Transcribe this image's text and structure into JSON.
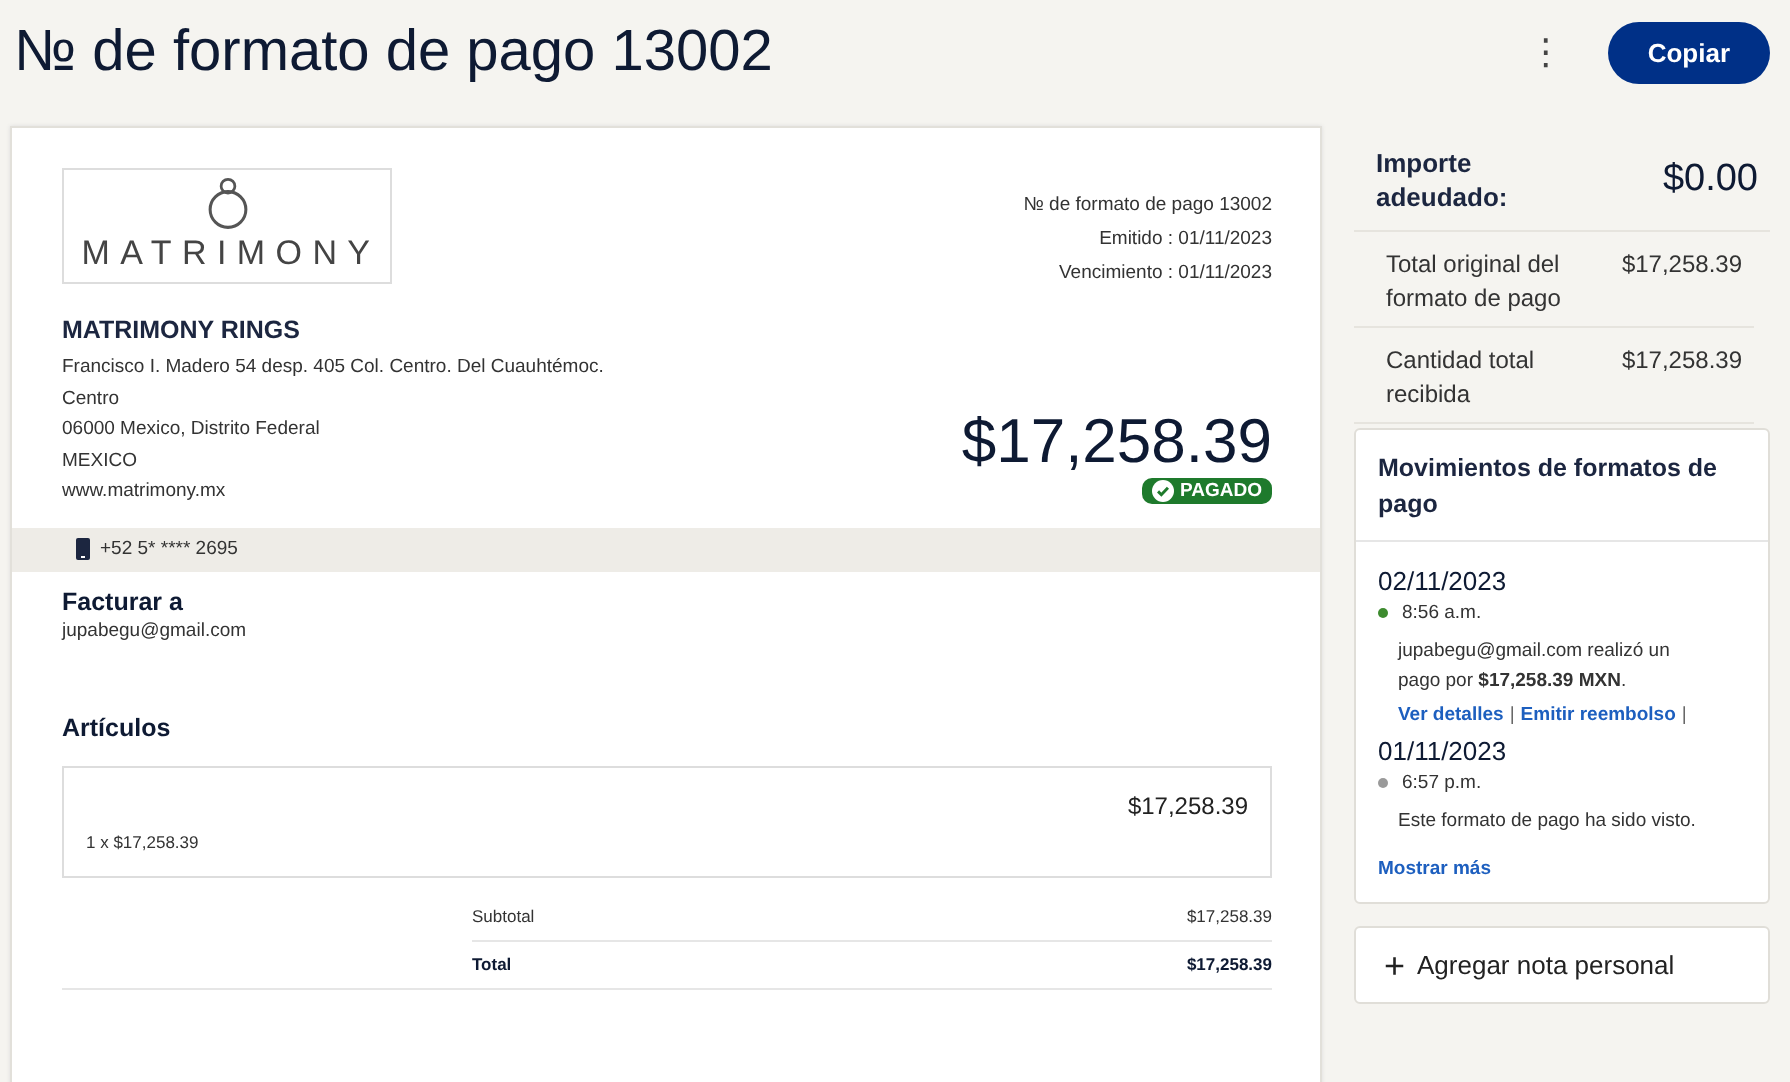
{
  "header": {
    "title": "№ de formato de pago 13002",
    "more_menu": "⋮",
    "copy_button": "Copiar"
  },
  "invoice": {
    "logo_text": "MATRIMONY",
    "meta": [
      "№ de formato de pago 13002",
      "Emitido : 01/11/2023",
      "Vencimiento : 01/11/2023"
    ],
    "merchant": {
      "name": "MATRIMONY RINGS",
      "address_lines": [
        "Francisco I. Madero 54 desp. 405 Col. Centro. Del Cuauhtémoc.",
        "Centro",
        "06000 Mexico, Distrito Federal",
        "MEXICO"
      ],
      "website": "www.matrimony.mx"
    },
    "amount": "$17,258.39",
    "status": {
      "label": "PAGADO",
      "kind": "paid"
    },
    "phone": "+52 5* **** 2695",
    "bill_to": {
      "heading": "Facturar a",
      "email": "jupabegu@gmail.com"
    },
    "items_heading": "Artículos",
    "items": [
      {
        "amount": "$17,258.39",
        "detail": "1 x $17,258.39"
      }
    ],
    "totals": [
      {
        "label": "Subtotal",
        "value": "$17,258.39",
        "bold": false
      },
      {
        "label": "Total",
        "value": "$17,258.39",
        "bold": true
      }
    ]
  },
  "summary": {
    "due_label": "Importe adeudado:",
    "due_value": "$0.00",
    "rows": [
      {
        "label": "Total original del formato de pago",
        "value": "$17,258.39"
      },
      {
        "label": "Cantidad total recibida",
        "value": "$17,258.39"
      }
    ]
  },
  "activity": {
    "title": "Movimientos de formatos de pago",
    "events": [
      {
        "date": "02/11/2023",
        "time": "8:56 a.m.",
        "color": "#3d8b2f",
        "message": "jupabegu@gmail.com realizó un pago por **$17,258.39 MXN**.",
        "links": [
          {
            "label": "Ver detalles"
          },
          {
            "label": "Emitir reembolso"
          }
        ],
        "separator": "|"
      },
      {
        "date": "01/11/2023",
        "time": "6:57 p.m.",
        "color": "#9a9a9a",
        "message": "Este formato de pago ha sido visto."
      }
    ],
    "show_more": "Mostrar más"
  },
  "note_button": {
    "icon": "+",
    "label": "Agregar nota personal"
  }
}
